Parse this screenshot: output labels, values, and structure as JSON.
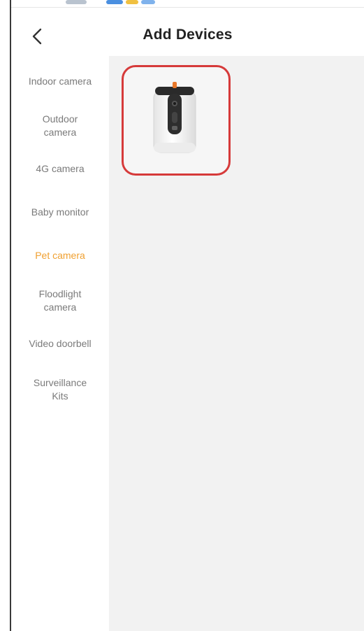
{
  "header": {
    "title": "Add Devices",
    "back_icon": "chevron-left-icon"
  },
  "sidebar": {
    "items": [
      {
        "label": "Indoor camera",
        "active": false
      },
      {
        "label": "Outdoor camera",
        "active": false
      },
      {
        "label": "4G camera",
        "active": false
      },
      {
        "label": "Baby monitor",
        "active": false
      },
      {
        "label": "Pet camera",
        "active": true
      },
      {
        "label": "Floodlight camera",
        "active": false
      },
      {
        "label": "Video doorbell",
        "active": false
      },
      {
        "label": "Surveillance Kits",
        "active": false
      }
    ]
  },
  "devices": [
    {
      "image_icon": "pet-camera-device-icon",
      "highlighted": true
    }
  ],
  "colors": {
    "active_item": "#f0a030",
    "inactive_item": "#7a7a7a",
    "title": "#222222",
    "content_bg": "#f2f2f2",
    "highlight_border": "#d63a3a"
  }
}
